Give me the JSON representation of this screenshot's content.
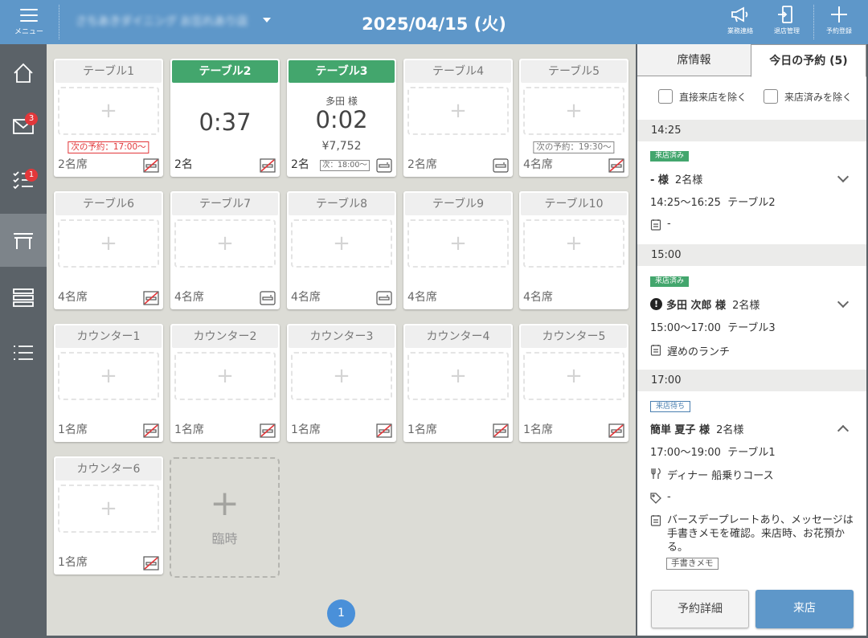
{
  "header": {
    "menu_label": "メニュー",
    "store_name": "さちあきダイニング お忘れあり店",
    "date": "2025/04/15 (火)",
    "actions": [
      {
        "label": "業務連絡",
        "icon": "megaphone-icon"
      },
      {
        "label": "退店管理",
        "icon": "exit-door-icon"
      },
      {
        "label": "予約登録",
        "icon": "plus-icon"
      }
    ]
  },
  "sidenav": {
    "items": [
      {
        "icon": "home-icon",
        "badge": ""
      },
      {
        "icon": "mail-icon",
        "badge": "3"
      },
      {
        "icon": "checklist-icon",
        "badge": "1"
      },
      {
        "icon": "table-icon",
        "badge": "",
        "active": true
      },
      {
        "icon": "layers-icon",
        "badge": ""
      },
      {
        "icon": "list-icon",
        "badge": ""
      }
    ]
  },
  "floor": {
    "plus": "+",
    "temp_label": "臨時",
    "page": "1",
    "tables": [
      {
        "name": "テーブル1",
        "seats": "2名席",
        "next": "次の予約：17:00～",
        "next_style": "red",
        "icon": "no-smoking-icon"
      },
      {
        "name": "テーブル2",
        "seats": "2名",
        "timer": "0:37",
        "occupied": true,
        "icon": "no-smoking-icon"
      },
      {
        "name": "テーブル3",
        "seats": "2名",
        "timer": "0:02",
        "guest": "多田 様",
        "amount": "¥7,752",
        "next_small": "次：18:00～",
        "occupied": true,
        "icon": "smoking-icon"
      },
      {
        "name": "テーブル4",
        "seats": "2名席",
        "icon": "smoking-icon"
      },
      {
        "name": "テーブル5",
        "seats": "4名席",
        "next": "次の予約：19:30～",
        "next_style": "gray",
        "icon": "no-smoking-icon"
      },
      {
        "name": "テーブル6",
        "seats": "4名席",
        "icon": "no-smoking-icon"
      },
      {
        "name": "テーブル7",
        "seats": "4名席",
        "icon": "smoking-icon"
      },
      {
        "name": "テーブル8",
        "seats": "4名席",
        "icon": "smoking-icon"
      },
      {
        "name": "テーブル9",
        "seats": "4名席",
        "icon": ""
      },
      {
        "name": "テーブル10",
        "seats": "4名席",
        "icon": ""
      },
      {
        "name": "カウンター1",
        "seats": "1名席",
        "icon": "no-smoking-icon"
      },
      {
        "name": "カウンター2",
        "seats": "1名席",
        "icon": "no-smoking-icon"
      },
      {
        "name": "カウンター3",
        "seats": "1名席",
        "icon": "no-smoking-icon"
      },
      {
        "name": "カウンター4",
        "seats": "1名席",
        "icon": "no-smoking-icon"
      },
      {
        "name": "カウンター5",
        "seats": "1名席",
        "icon": "no-smoking-icon"
      },
      {
        "name": "カウンター6",
        "seats": "1名席",
        "icon": "no-smoking-icon"
      }
    ]
  },
  "panel": {
    "tabs": [
      "席情報",
      "今日の予約 (5)"
    ],
    "filters": [
      "直接来店を除く",
      "来店済みを除く"
    ],
    "reservations": [
      {
        "time_head": "14:25",
        "status": "来店済み",
        "name": "- 様",
        "party": "2名様",
        "time": "14:25～16:25",
        "table": "テーブル2",
        "memo": "-"
      },
      {
        "time_head": "15:00",
        "status": "来店済み",
        "warn": "!",
        "name": "多田 次郎 様",
        "party": "2名様",
        "time": "15:00～17:00",
        "table": "テーブル3",
        "memo": "遅めのランチ"
      },
      {
        "time_head": "17:00",
        "status": "来店待ち",
        "name": "簡単 夏子 様",
        "party": "2名様",
        "time": "17:00～19:00",
        "table": "テーブル1",
        "course": "ディナー 船乗りコース",
        "tag": "-",
        "memo": "バースデープレートあり、メッセージは手書きメモを確認。来店時、お花預かる。",
        "memo_tag": "手書きメモ"
      }
    ],
    "detail_button": "予約詳細",
    "arrive_button": "来店"
  },
  "colors": {
    "header": "#5e97c9",
    "occupied": "#43a66d",
    "alert": "#e2373a",
    "sidebar": "#5b6268"
  }
}
